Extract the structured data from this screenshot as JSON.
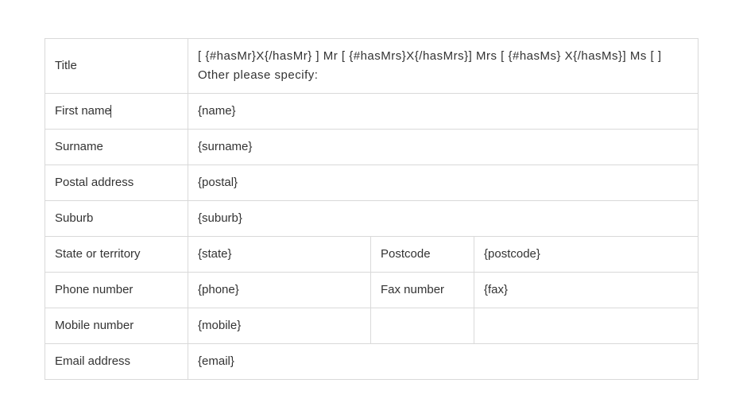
{
  "rows": {
    "title": {
      "label": "Title",
      "value": "[  {#hasMr}X{/hasMr}  ]  Mr   [  {#hasMrs}X{/hasMrs}]    Mrs   [  {#hasMs}  X{/hasMs}]   Ms  [   ]   Other please specify:"
    },
    "firstName": {
      "label": "First name",
      "value": "{name}"
    },
    "surname": {
      "label": "Surname",
      "value": "{surname}"
    },
    "postal": {
      "label": "Postal address",
      "value": "{postal}"
    },
    "suburb": {
      "label": "Suburb",
      "value": "{suburb}"
    },
    "state": {
      "label": "State or territory",
      "value": "{state}"
    },
    "postcode": {
      "label": "Postcode",
      "value": "{postcode}"
    },
    "phone": {
      "label": "Phone number",
      "value": "{phone}"
    },
    "fax": {
      "label": "Fax number",
      "value": "{fax}"
    },
    "mobile": {
      "label": "Mobile number",
      "value": "{mobile}"
    },
    "email": {
      "label": "Email address",
      "value": "{email}"
    }
  }
}
